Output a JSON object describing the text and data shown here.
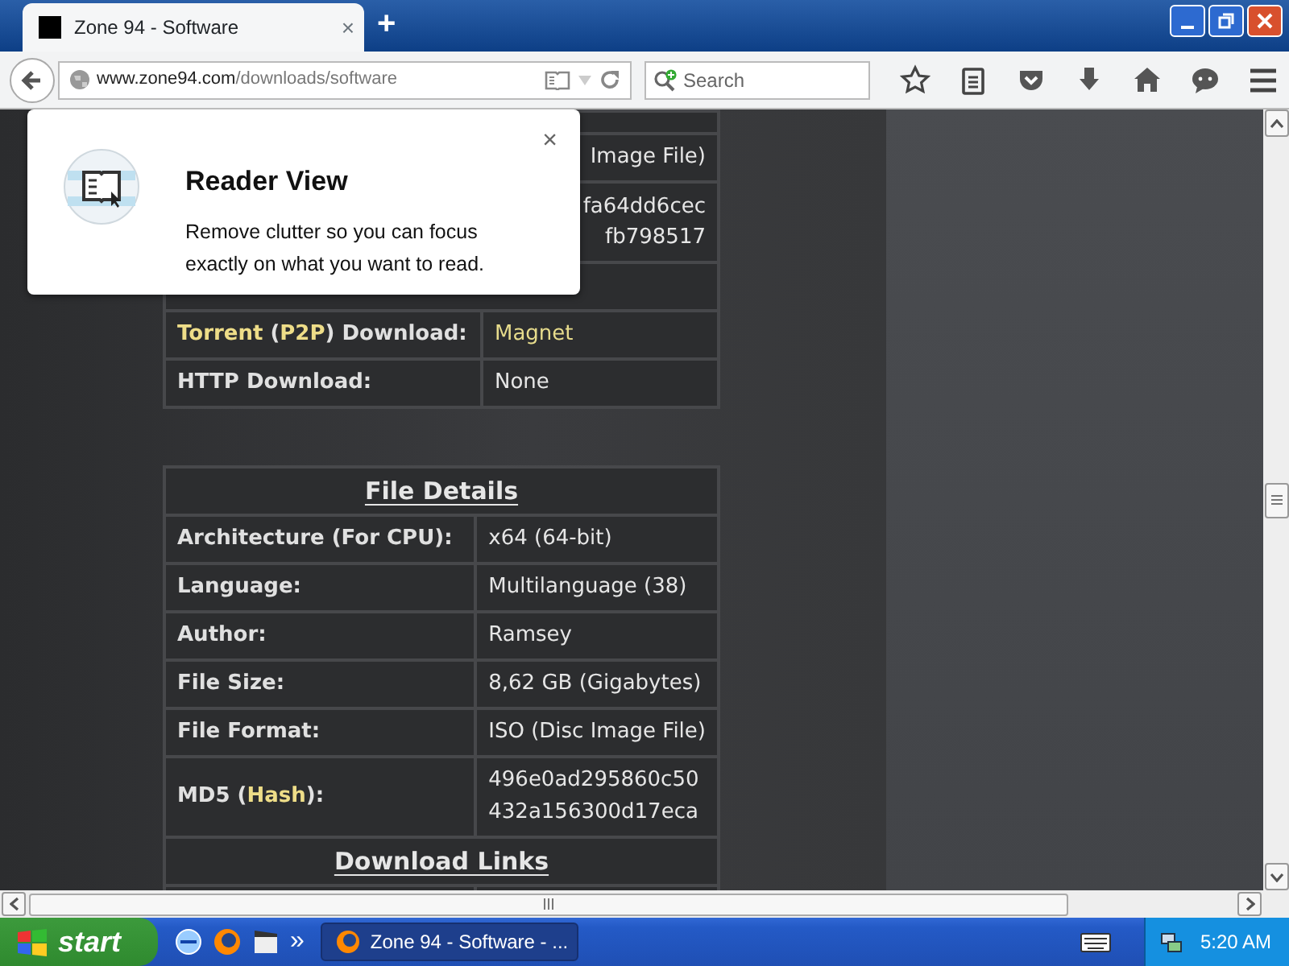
{
  "browser": {
    "tab": {
      "title": "Zone 94 - Software",
      "close": "×",
      "new_tab": "+"
    },
    "url": {
      "host": "www.zone94.com",
      "path": "/downloads/software"
    },
    "search": {
      "placeholder": "Search"
    }
  },
  "reader_popup": {
    "title": "Reader View",
    "text": "Remove clutter so you can focus exactly on what you want to read.",
    "close": "×"
  },
  "top_table": {
    "partial_rows": [
      {
        "value_lines": [
          "Image File)"
        ]
      },
      {
        "value_lines": [
          "fa64dd6cec",
          "fb798517"
        ]
      }
    ],
    "rows": [
      {
        "label": [
          {
            "text": "Torrent",
            "highlight": true
          },
          {
            "text": " (",
            "highlight": false
          },
          {
            "text": "P2P",
            "highlight": true
          },
          {
            "text": ") Download:",
            "highlight": false
          }
        ],
        "value_lines": [
          "Magnet"
        ],
        "link": true
      },
      {
        "label": [
          {
            "text": "HTTP Download:",
            "highlight": false
          }
        ],
        "value_lines": [
          "None"
        ],
        "link": false
      }
    ]
  },
  "file_details": {
    "heading": "File Details",
    "rows": [
      {
        "label": [
          {
            "text": "Architecture (For CPU):",
            "highlight": false
          }
        ],
        "value_lines": [
          "x64 (64-bit)"
        ]
      },
      {
        "label": [
          {
            "text": "Language:",
            "highlight": false
          }
        ],
        "value_lines": [
          "Multilanguage (38)"
        ]
      },
      {
        "label": [
          {
            "text": "Author:",
            "highlight": false
          }
        ],
        "value_lines": [
          "Ramsey"
        ]
      },
      {
        "label": [
          {
            "text": "File Size:",
            "highlight": false
          }
        ],
        "value_lines": [
          "8,62 GB (Gigabytes)"
        ]
      },
      {
        "label": [
          {
            "text": "File Format:",
            "highlight": false
          }
        ],
        "value_lines": [
          "ISO (Disc Image File)"
        ]
      },
      {
        "label": [
          {
            "text": "MD5 (",
            "highlight": false
          },
          {
            "text": "Hash",
            "highlight": true
          },
          {
            "text": "):",
            "highlight": false
          }
        ],
        "value_lines": [
          "496e0ad295860c50",
          "432a156300d17eca"
        ]
      }
    ],
    "next_heading": "Download Links"
  },
  "taskbar": {
    "start": "start",
    "overflow": "»",
    "task": "Zone 94 - Software - ...",
    "clock": "5:20 AM"
  }
}
